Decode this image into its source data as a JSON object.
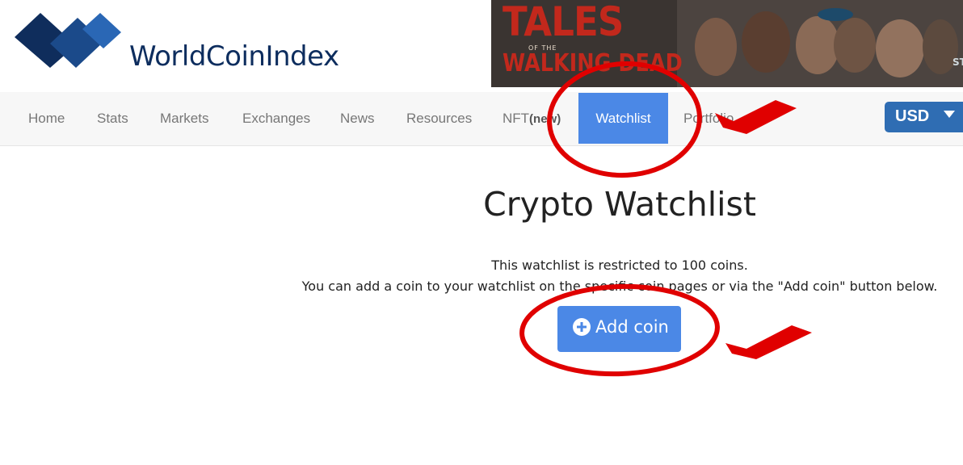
{
  "brand": {
    "name": "WorldCoinIndex",
    "icon": "wci-logo-icon",
    "color": "#0d2d5e"
  },
  "ad": {
    "title_line1": "TALES",
    "subtitle": "OF THE",
    "title_line2": "WALKING DEAD",
    "corner": "ST"
  },
  "nav": {
    "items": [
      {
        "label": "Home"
      },
      {
        "label": "Stats"
      },
      {
        "label": "Markets"
      },
      {
        "label": "Exchanges"
      },
      {
        "label": "News"
      },
      {
        "label": "Resources"
      },
      {
        "label": "NFT",
        "badge": "(new)"
      },
      {
        "label": "Watchlist",
        "active": true
      },
      {
        "label": "Portfolio"
      }
    ],
    "active_color": "#4b88e6",
    "currency": {
      "label": "USD",
      "caret": "chevron-down-icon"
    }
  },
  "main": {
    "title": "Crypto Watchlist",
    "desc_line1": "This watchlist is restricted to 100 coins.",
    "desc_line2": "You can add a coin to your watchlist on the specific coin pages or via the \"Add coin\" button below.",
    "add_button": {
      "label": "Add coin",
      "icon": "plus-circle-icon"
    }
  },
  "annotations": {
    "color": "#e00000",
    "marks": [
      "circle",
      "checkmark"
    ]
  }
}
